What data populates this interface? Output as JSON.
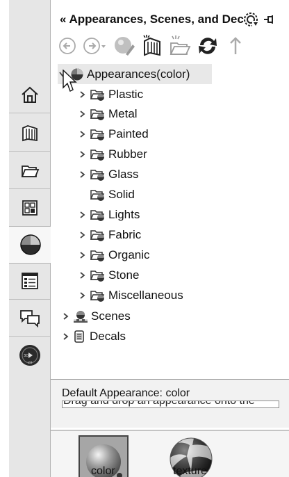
{
  "header": {
    "collapse_glyph": "«",
    "title": "Appearances, Scenes, and Decals",
    "options_icon": "gear-icon",
    "pin_icon": "pin-icon"
  },
  "toolbar": {
    "buttons": [
      {
        "name": "back-button",
        "icon": "back-arrow-icon"
      },
      {
        "name": "forward-button",
        "icon": "forward-arrow-icon"
      },
      {
        "name": "edit-appearance-button",
        "icon": "edit-appearance-icon"
      },
      {
        "name": "library-button",
        "icon": "library-icon"
      },
      {
        "name": "new-folder-button",
        "icon": "new-folder-icon"
      },
      {
        "name": "refresh-button",
        "icon": "refresh-icon"
      },
      {
        "name": "up-button",
        "icon": "up-arrow-icon"
      }
    ]
  },
  "sidebar": {
    "items": [
      {
        "name": "home",
        "icon": "home-icon"
      },
      {
        "name": "design-library",
        "icon": "library-icon"
      },
      {
        "name": "file-explorer",
        "icon": "folder-icon"
      },
      {
        "name": "view-palette",
        "icon": "view-palette-icon"
      },
      {
        "name": "appearances",
        "icon": "appearance-sphere-icon",
        "active": true
      },
      {
        "name": "custom-properties",
        "icon": "properties-icon"
      },
      {
        "name": "forum",
        "icon": "chat-icon"
      },
      {
        "name": "3dexperience",
        "icon": "compass-icon"
      }
    ]
  },
  "tree": {
    "root": "Appearances(color)",
    "children": [
      "Plastic",
      "Metal",
      "Painted",
      "Rubber",
      "Glass",
      "Solid",
      "Lights",
      "Fabric",
      "Organic",
      "Stone",
      "Miscellaneous"
    ],
    "siblings": [
      "Scenes",
      "Decals"
    ]
  },
  "info": {
    "label": "Default Appearance: color",
    "partial_text": "Drag and drop an appearance onto the"
  },
  "gallery": {
    "items": [
      {
        "label": "color",
        "selected": true
      },
      {
        "label": "texture",
        "selected": false
      }
    ]
  },
  "colors": {
    "sidebar_bg": "#e6e6e6",
    "selection_bg": "#e8e8e8",
    "accent_icon": "#2a2a2a"
  }
}
